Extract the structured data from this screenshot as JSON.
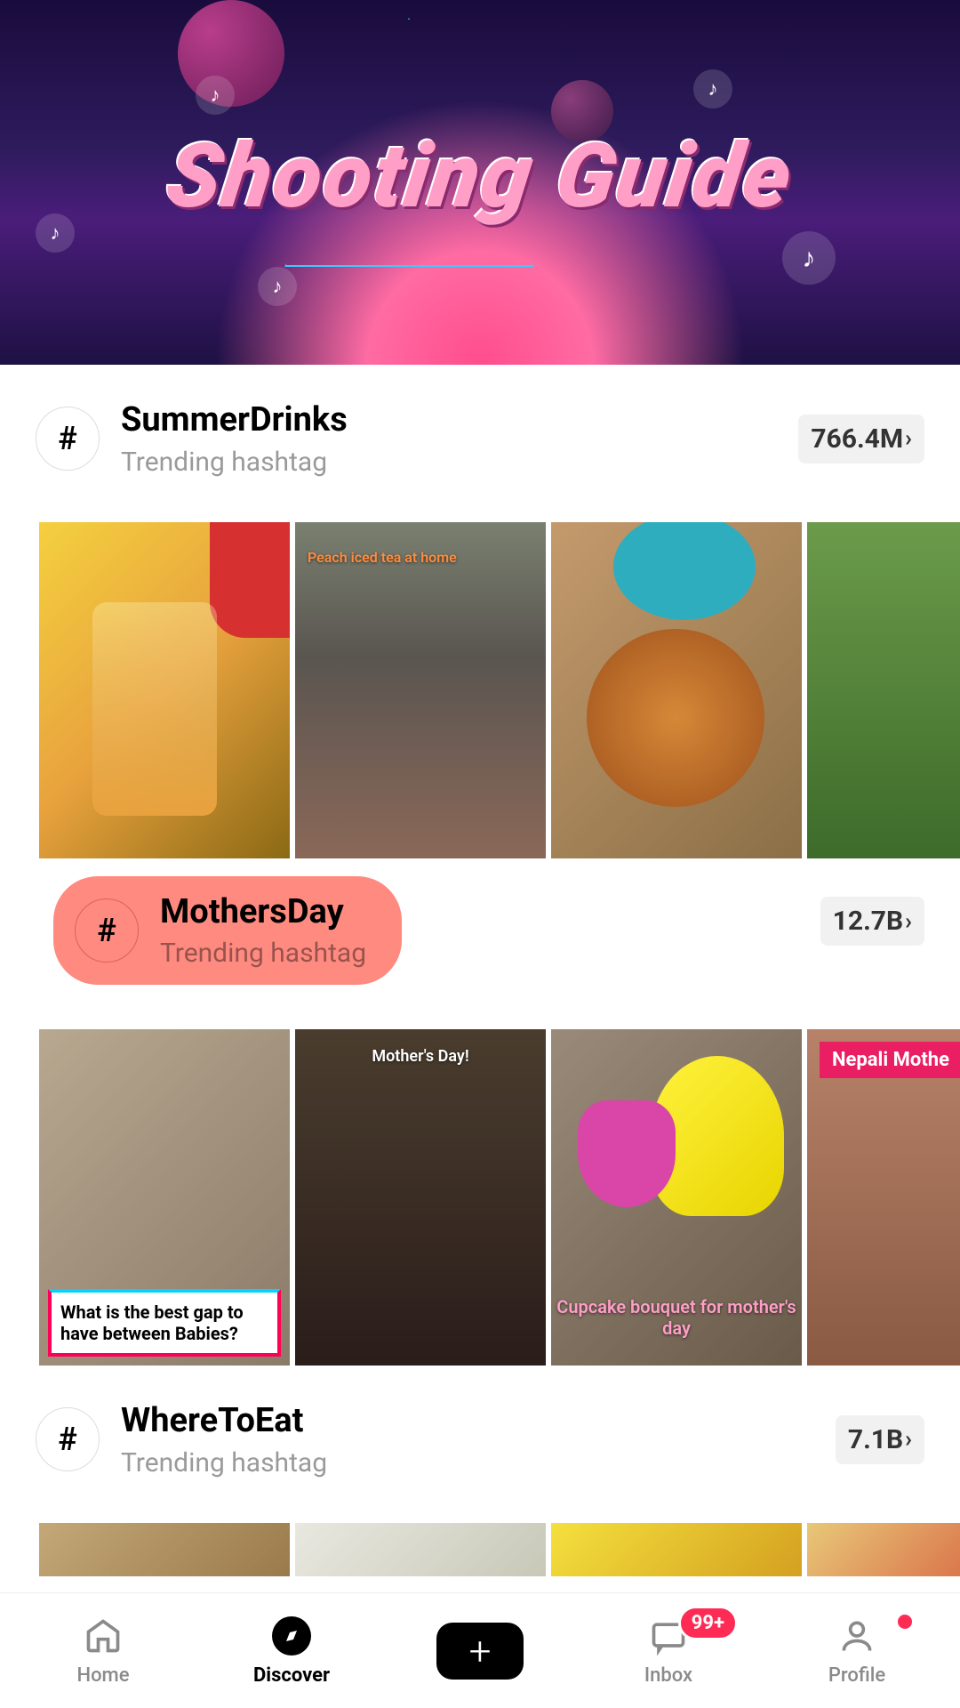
{
  "banner": {
    "title": "Shooting Guide"
  },
  "sections": [
    {
      "name": "SummerDrinks",
      "subtitle": "Trending hashtag",
      "count": "766.4M",
      "highlighted": false,
      "thumbs": [
        {
          "caption": ""
        },
        {
          "caption": "Peach iced tea at home"
        },
        {
          "caption": ""
        },
        {
          "caption": ""
        }
      ]
    },
    {
      "name": "MothersDay",
      "subtitle": "Trending hashtag",
      "count": "12.7B",
      "highlighted": true,
      "thumbs": [
        {
          "caption": "What is the best gap to have between Babies?"
        },
        {
          "caption": "Mother's Day!"
        },
        {
          "caption": "Cupcake bouquet for mother's day"
        },
        {
          "caption": "Nepali Mothe"
        }
      ]
    },
    {
      "name": "WhereToEat",
      "subtitle": "Trending hashtag",
      "count": "7.1B",
      "highlighted": false,
      "thumbs": [
        {
          "caption": ""
        },
        {
          "caption": ""
        },
        {
          "caption": ""
        },
        {
          "caption": ""
        }
      ]
    }
  ],
  "tabbar": {
    "home": "Home",
    "discover": "Discover",
    "inbox": "Inbox",
    "inbox_badge": "99+",
    "profile": "Profile"
  },
  "hash_symbol": "#"
}
